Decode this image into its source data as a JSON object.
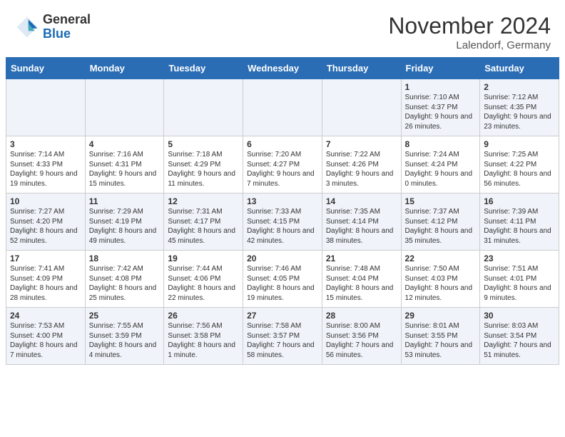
{
  "header": {
    "logo_general": "General",
    "logo_blue": "Blue",
    "month_title": "November 2024",
    "location": "Lalendorf, Germany"
  },
  "days_of_week": [
    "Sunday",
    "Monday",
    "Tuesday",
    "Wednesday",
    "Thursday",
    "Friday",
    "Saturday"
  ],
  "weeks": [
    [
      {
        "day": "",
        "info": ""
      },
      {
        "day": "",
        "info": ""
      },
      {
        "day": "",
        "info": ""
      },
      {
        "day": "",
        "info": ""
      },
      {
        "day": "",
        "info": ""
      },
      {
        "day": "1",
        "info": "Sunrise: 7:10 AM\nSunset: 4:37 PM\nDaylight: 9 hours and 26 minutes."
      },
      {
        "day": "2",
        "info": "Sunrise: 7:12 AM\nSunset: 4:35 PM\nDaylight: 9 hours and 23 minutes."
      }
    ],
    [
      {
        "day": "3",
        "info": "Sunrise: 7:14 AM\nSunset: 4:33 PM\nDaylight: 9 hours and 19 minutes."
      },
      {
        "day": "4",
        "info": "Sunrise: 7:16 AM\nSunset: 4:31 PM\nDaylight: 9 hours and 15 minutes."
      },
      {
        "day": "5",
        "info": "Sunrise: 7:18 AM\nSunset: 4:29 PM\nDaylight: 9 hours and 11 minutes."
      },
      {
        "day": "6",
        "info": "Sunrise: 7:20 AM\nSunset: 4:27 PM\nDaylight: 9 hours and 7 minutes."
      },
      {
        "day": "7",
        "info": "Sunrise: 7:22 AM\nSunset: 4:26 PM\nDaylight: 9 hours and 3 minutes."
      },
      {
        "day": "8",
        "info": "Sunrise: 7:24 AM\nSunset: 4:24 PM\nDaylight: 9 hours and 0 minutes."
      },
      {
        "day": "9",
        "info": "Sunrise: 7:25 AM\nSunset: 4:22 PM\nDaylight: 8 hours and 56 minutes."
      }
    ],
    [
      {
        "day": "10",
        "info": "Sunrise: 7:27 AM\nSunset: 4:20 PM\nDaylight: 8 hours and 52 minutes."
      },
      {
        "day": "11",
        "info": "Sunrise: 7:29 AM\nSunset: 4:19 PM\nDaylight: 8 hours and 49 minutes."
      },
      {
        "day": "12",
        "info": "Sunrise: 7:31 AM\nSunset: 4:17 PM\nDaylight: 8 hours and 45 minutes."
      },
      {
        "day": "13",
        "info": "Sunrise: 7:33 AM\nSunset: 4:15 PM\nDaylight: 8 hours and 42 minutes."
      },
      {
        "day": "14",
        "info": "Sunrise: 7:35 AM\nSunset: 4:14 PM\nDaylight: 8 hours and 38 minutes."
      },
      {
        "day": "15",
        "info": "Sunrise: 7:37 AM\nSunset: 4:12 PM\nDaylight: 8 hours and 35 minutes."
      },
      {
        "day": "16",
        "info": "Sunrise: 7:39 AM\nSunset: 4:11 PM\nDaylight: 8 hours and 31 minutes."
      }
    ],
    [
      {
        "day": "17",
        "info": "Sunrise: 7:41 AM\nSunset: 4:09 PM\nDaylight: 8 hours and 28 minutes."
      },
      {
        "day": "18",
        "info": "Sunrise: 7:42 AM\nSunset: 4:08 PM\nDaylight: 8 hours and 25 minutes."
      },
      {
        "day": "19",
        "info": "Sunrise: 7:44 AM\nSunset: 4:06 PM\nDaylight: 8 hours and 22 minutes."
      },
      {
        "day": "20",
        "info": "Sunrise: 7:46 AM\nSunset: 4:05 PM\nDaylight: 8 hours and 19 minutes."
      },
      {
        "day": "21",
        "info": "Sunrise: 7:48 AM\nSunset: 4:04 PM\nDaylight: 8 hours and 15 minutes."
      },
      {
        "day": "22",
        "info": "Sunrise: 7:50 AM\nSunset: 4:03 PM\nDaylight: 8 hours and 12 minutes."
      },
      {
        "day": "23",
        "info": "Sunrise: 7:51 AM\nSunset: 4:01 PM\nDaylight: 8 hours and 9 minutes."
      }
    ],
    [
      {
        "day": "24",
        "info": "Sunrise: 7:53 AM\nSunset: 4:00 PM\nDaylight: 8 hours and 7 minutes."
      },
      {
        "day": "25",
        "info": "Sunrise: 7:55 AM\nSunset: 3:59 PM\nDaylight: 8 hours and 4 minutes."
      },
      {
        "day": "26",
        "info": "Sunrise: 7:56 AM\nSunset: 3:58 PM\nDaylight: 8 hours and 1 minute."
      },
      {
        "day": "27",
        "info": "Sunrise: 7:58 AM\nSunset: 3:57 PM\nDaylight: 7 hours and 58 minutes."
      },
      {
        "day": "28",
        "info": "Sunrise: 8:00 AM\nSunset: 3:56 PM\nDaylight: 7 hours and 56 minutes."
      },
      {
        "day": "29",
        "info": "Sunrise: 8:01 AM\nSunset: 3:55 PM\nDaylight: 7 hours and 53 minutes."
      },
      {
        "day": "30",
        "info": "Sunrise: 8:03 AM\nSunset: 3:54 PM\nDaylight: 7 hours and 51 minutes."
      }
    ]
  ]
}
